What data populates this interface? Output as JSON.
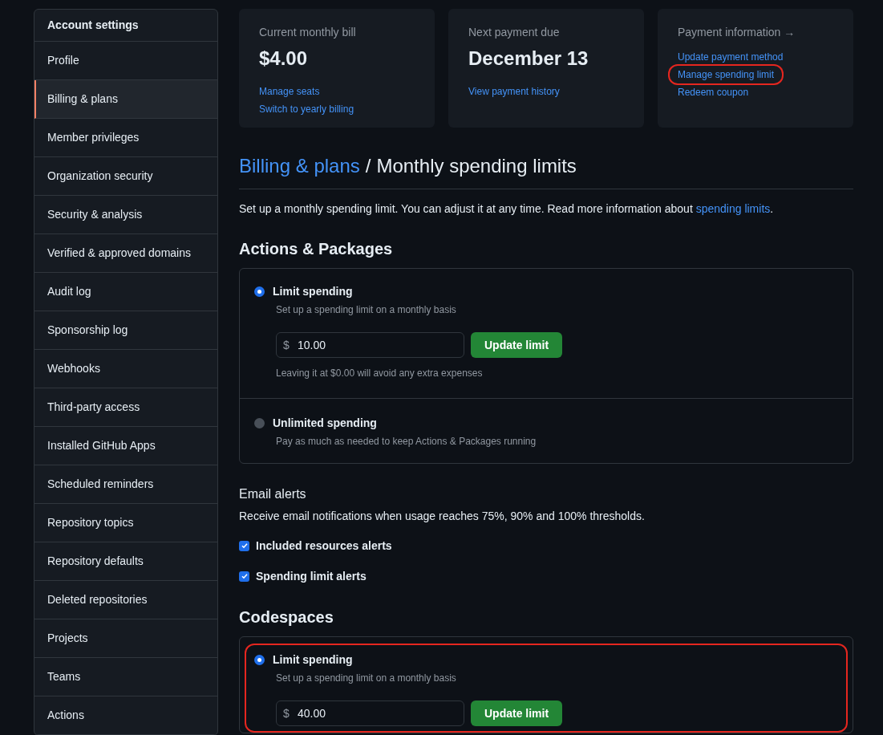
{
  "sidebar": {
    "title": "Account settings",
    "items": [
      {
        "label": "Profile",
        "selected": false
      },
      {
        "label": "Billing & plans",
        "selected": true
      },
      {
        "label": "Member privileges",
        "selected": false
      },
      {
        "label": "Organization security",
        "selected": false
      },
      {
        "label": "Security & analysis",
        "selected": false
      },
      {
        "label": "Verified & approved domains",
        "selected": false
      },
      {
        "label": "Audit log",
        "selected": false
      },
      {
        "label": "Sponsorship log",
        "selected": false
      },
      {
        "label": "Webhooks",
        "selected": false
      },
      {
        "label": "Third-party access",
        "selected": false
      },
      {
        "label": "Installed GitHub Apps",
        "selected": false
      },
      {
        "label": "Scheduled reminders",
        "selected": false
      },
      {
        "label": "Repository topics",
        "selected": false
      },
      {
        "label": "Repository defaults",
        "selected": false
      },
      {
        "label": "Deleted repositories",
        "selected": false
      },
      {
        "label": "Projects",
        "selected": false
      },
      {
        "label": "Teams",
        "selected": false
      },
      {
        "label": "Actions",
        "selected": false
      }
    ]
  },
  "cards": [
    {
      "title": "Current monthly bill",
      "value": "$4.00",
      "links": [
        {
          "label": "Manage seats",
          "highlighted": false
        },
        {
          "label": "Switch to yearly billing",
          "highlighted": false
        }
      ]
    },
    {
      "title": "Next payment due",
      "value": "December 13",
      "links": [
        {
          "label": "View payment history",
          "highlighted": false
        }
      ]
    },
    {
      "title": "Payment information →",
      "links": [
        {
          "label": "Update payment method",
          "highlighted": false
        },
        {
          "label": "Manage spending limit",
          "highlighted": true
        },
        {
          "label": "Redeem coupon",
          "highlighted": false
        }
      ]
    }
  ],
  "breadcrumb": {
    "link": "Billing & plans",
    "separator": "/",
    "current": "Monthly spending limits"
  },
  "intro": {
    "text": "Set up a monthly spending limit. You can adjust it at any time. Read more information about",
    "link": "spending limits",
    "end": "."
  },
  "sections": [
    {
      "title": "Actions & Packages",
      "options": [
        {
          "label": "Limit spending",
          "description": "Set up a spending limit on a monthly basis",
          "selected": true,
          "highlighted": false,
          "prefix": "$",
          "value": "10.00",
          "button": "Update limit",
          "note": "Leaving it at $0.00 will avoid any extra expenses"
        },
        {
          "label": "Unlimited spending",
          "description": "Pay as much as needed to keep Actions & Packages running",
          "selected": false,
          "highlighted": false
        }
      ],
      "email_alerts": {
        "title": "Email alerts",
        "description": "Receive email notifications when usage reaches 75%, 90% and 100% thresholds.",
        "checkboxes": [
          {
            "label": "Included resources alerts",
            "checked": true
          },
          {
            "label": "Spending limit alerts",
            "checked": true
          }
        ]
      }
    },
    {
      "title": "Codespaces",
      "options": [
        {
          "label": "Limit spending",
          "description": "Set up a spending limit on a monthly basis",
          "selected": true,
          "highlighted": true,
          "prefix": "$",
          "value": "40.00",
          "button": "Update limit"
        }
      ]
    }
  ]
}
